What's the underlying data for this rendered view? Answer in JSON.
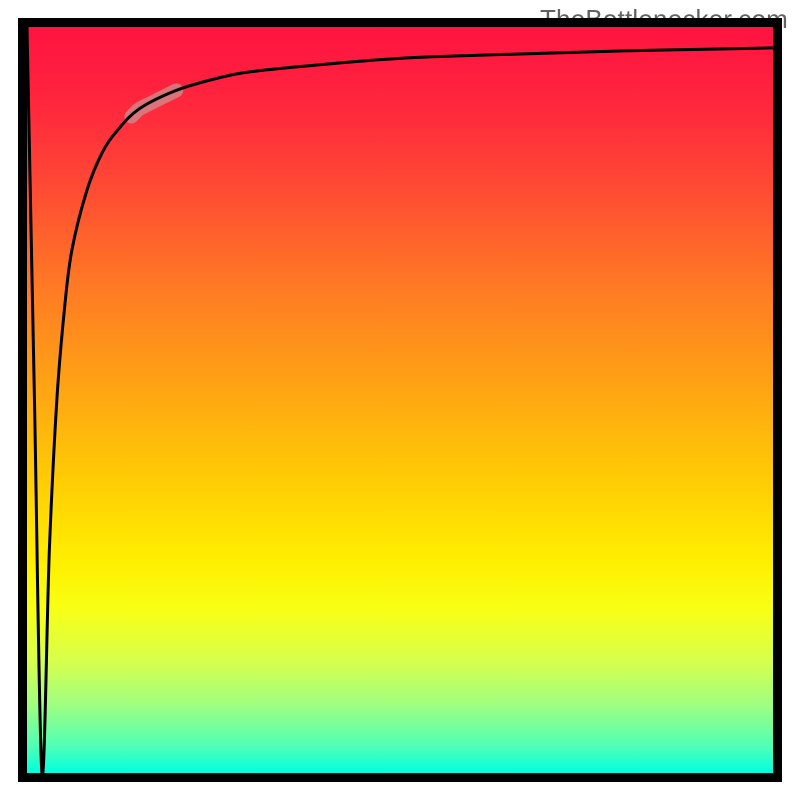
{
  "attribution": {
    "label": "TheBottlenecker.com"
  },
  "chart_data": {
    "type": "line",
    "title": "",
    "xlabel": "",
    "ylabel": "",
    "x": [
      0,
      1,
      2,
      3,
      4,
      5,
      6,
      8,
      10,
      12,
      15,
      20,
      25,
      30,
      40,
      50,
      60,
      70,
      80,
      90,
      100
    ],
    "values": [
      100,
      50,
      0,
      30,
      50,
      62,
      70,
      78,
      83,
      86,
      89,
      91.5,
      93,
      94,
      95,
      95.8,
      96.2,
      96.5,
      96.8,
      97,
      97.2
    ],
    "xlim": [
      0,
      100
    ],
    "ylim": [
      0,
      100
    ],
    "highlight_range_x": [
      14,
      20
    ],
    "gradient_stops": [
      {
        "offset": 0.0,
        "color": "#ff1440"
      },
      {
        "offset": 0.05,
        "color": "#ff1b3f"
      },
      {
        "offset": 0.12,
        "color": "#ff2b3c"
      },
      {
        "offset": 0.22,
        "color": "#ff4c33"
      },
      {
        "offset": 0.35,
        "color": "#ff7a24"
      },
      {
        "offset": 0.48,
        "color": "#ffa314"
      },
      {
        "offset": 0.6,
        "color": "#ffca05"
      },
      {
        "offset": 0.72,
        "color": "#fff000"
      },
      {
        "offset": 0.78,
        "color": "#f8ff15"
      },
      {
        "offset": 0.85,
        "color": "#d7ff4c"
      },
      {
        "offset": 0.91,
        "color": "#9dff81"
      },
      {
        "offset": 0.965,
        "color": "#4effb7"
      },
      {
        "offset": 1.0,
        "color": "#00ffe0"
      }
    ],
    "frame": {
      "margin": 27,
      "stroke": "#000000",
      "stroke_width": 9
    },
    "curve_style": {
      "stroke": "#000000",
      "stroke_width": 3
    },
    "highlight_style": {
      "stroke": "#cf8b8b",
      "stroke_width": 14,
      "opacity": 0.78
    }
  }
}
